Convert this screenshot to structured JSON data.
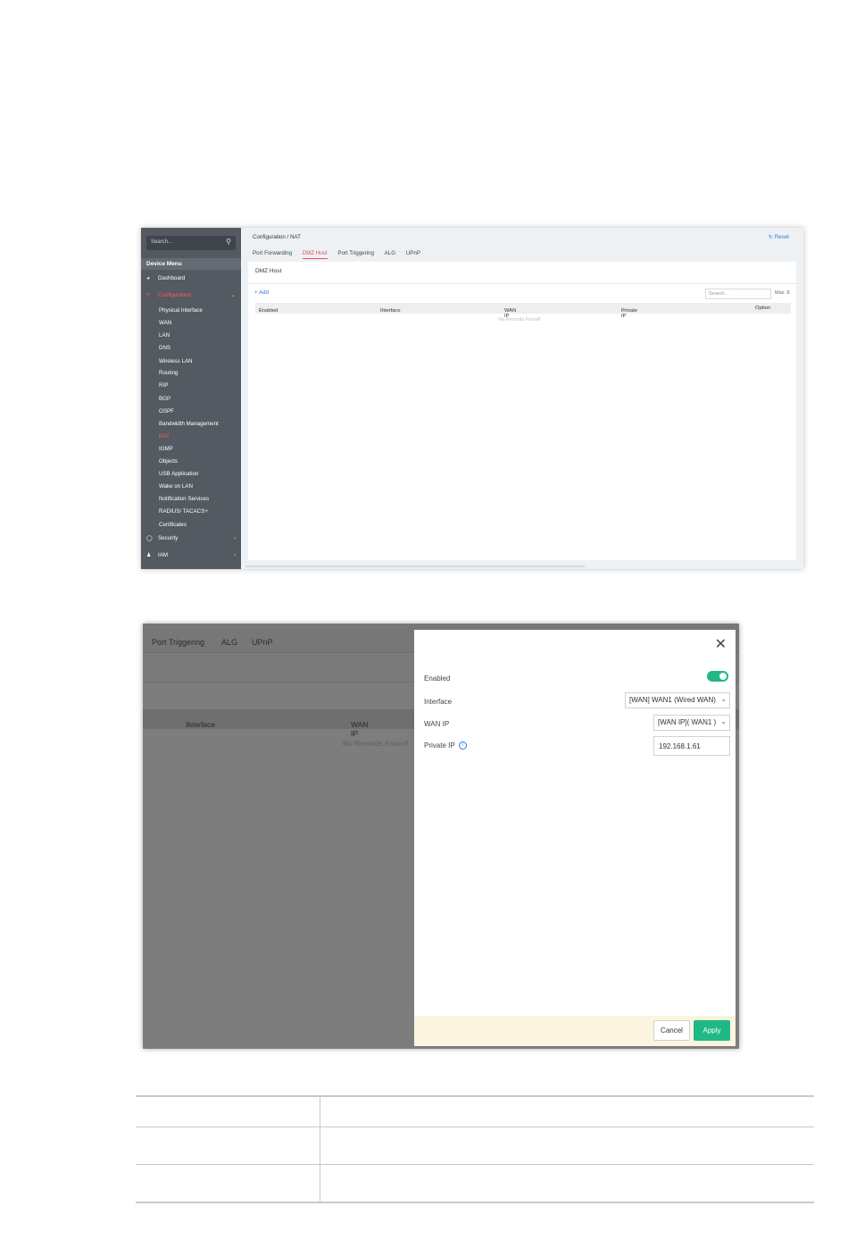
{
  "screen1": {
    "sidebar": {
      "search_placeholder": "Search...",
      "menu_header": "Device Menu",
      "top_items": [
        {
          "label": "Dashboard",
          "icon": "gauge-icon"
        },
        {
          "label": "Configuration",
          "icon": "sliders-icon"
        },
        {
          "label": "Security",
          "icon": "shield-icon"
        },
        {
          "label": "IAM",
          "icon": "users-icon"
        }
      ],
      "sub_items": [
        "Physical Interface",
        "WAN",
        "LAN",
        "DNS",
        "Wireless LAN",
        "Routing",
        "RIP",
        "BGP",
        "OSPF",
        "Bandwidth Management",
        "NAT",
        "IGMP",
        "Objects",
        "USB Application",
        "Wake on LAN",
        "Notification Services",
        "RADIUS/ TACACS+",
        "Certificates"
      ],
      "active_sub_item": "NAT"
    },
    "breadcrumb": "Configuration / NAT",
    "reset_label": "Reset",
    "tabs": [
      "Port Forwarding",
      "DMZ Host",
      "Port Triggering",
      "ALG",
      "UPnP"
    ],
    "active_tab": "DMZ Host",
    "panel_title": "DMZ Host",
    "add_label": "+ Add",
    "search_placeholder": "Search...",
    "max_label": "Max: 8",
    "columns": [
      "Enabled",
      "Interface",
      "WAN IP",
      "Private IP",
      "Option"
    ],
    "empty_text": "No Records Found!"
  },
  "screen2": {
    "bg_tabs": [
      "Port Triggering",
      "ALG",
      "UPnP"
    ],
    "bg_columns": [
      "Interface",
      "WAN IP"
    ],
    "bg_empty_text": "No Records Found!",
    "dialog": {
      "enabled_label": "Enabled",
      "enabled_value": true,
      "interface_label": "Interface",
      "interface_value": "[WAN] WAN1 (Wired WAN)",
      "wan_ip_label": "WAN IP",
      "wan_ip_value": "[WAN IP]( WAN1 )",
      "private_ip_label": "Private IP",
      "private_ip_value": "192.168.1.61",
      "cancel_label": "Cancel",
      "apply_label": "Apply"
    }
  },
  "colors": {
    "accent_green": "#1fb887",
    "active_red": "#e55454",
    "link_blue": "#2a7fd4",
    "sidebar_bg": "#535a61"
  }
}
